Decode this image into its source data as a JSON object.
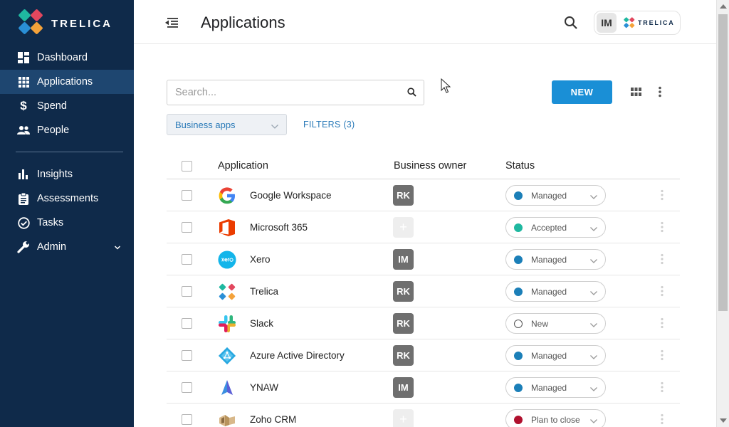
{
  "brand": {
    "name": "TRELICA"
  },
  "sidebar": {
    "items": [
      {
        "label": "Dashboard"
      },
      {
        "label": "Applications"
      },
      {
        "label": "Spend"
      },
      {
        "label": "People"
      },
      {
        "label": "Insights"
      },
      {
        "label": "Assessments"
      },
      {
        "label": "Tasks"
      },
      {
        "label": "Admin"
      }
    ]
  },
  "header": {
    "title": "Applications",
    "user_initials": "IM",
    "org_name": "TRELICA"
  },
  "toolbar": {
    "search_placeholder": "Search...",
    "new_label": "NEW",
    "filter_select": "Business apps",
    "filters_label": "FILTERS (3)"
  },
  "table": {
    "columns": {
      "application": "Application",
      "owner": "Business owner",
      "status": "Status"
    },
    "rows": [
      {
        "name": "Google Workspace",
        "owner": "RK",
        "status": "Managed",
        "status_color": "#1b7fb8",
        "icon": "google-icon"
      },
      {
        "name": "Microsoft 365",
        "owner": "+",
        "status": "Accepted",
        "status_color": "#1fb8a0",
        "icon": "office-icon"
      },
      {
        "name": "Xero",
        "owner": "IM",
        "status": "Managed",
        "status_color": "#1b7fb8",
        "icon": "xero-icon"
      },
      {
        "name": "Trelica",
        "owner": "RK",
        "status": "Managed",
        "status_color": "#1b7fb8",
        "icon": "trelica-icon"
      },
      {
        "name": "Slack",
        "owner": "RK",
        "status": "New",
        "status_color": "#ffffff",
        "icon": "slack-icon"
      },
      {
        "name": "Azure Active Directory",
        "owner": "RK",
        "status": "Managed",
        "status_color": "#1b7fb8",
        "icon": "azure-ad-icon"
      },
      {
        "name": "YNAW",
        "owner": "IM",
        "status": "Managed",
        "status_color": "#1b7fb8",
        "icon": "ynaw-icon"
      },
      {
        "name": "Zoho CRM",
        "owner": "+",
        "status": "Plan to close",
        "status_color": "#b0102e",
        "icon": "zoho-crm-icon"
      }
    ]
  },
  "colors": {
    "sidebar_bg": "#0f2a4a",
    "sidebar_active": "#1e4670",
    "accent": "#1a8fd6",
    "link": "#2a7ab8"
  }
}
